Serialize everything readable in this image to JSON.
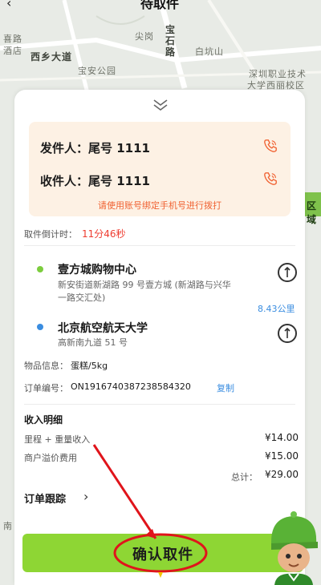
{
  "header": {
    "title": "待取件",
    "back_icon": "chevron-left-icon"
  },
  "map": {
    "labels": [
      "喜路",
      "酒店",
      "西乡大道",
      "尖岗",
      "宝石路",
      "白坑山",
      "宝安公园",
      "深圳职业技术",
      "大学西丽校区",
      "区域",
      "南"
    ]
  },
  "contact": {
    "sender_label": "发件人：尾号 1111",
    "receiver_label": "收件人：尾号 1111",
    "note": "请使用账号绑定手机号进行拨打",
    "accent": "#f06232"
  },
  "countdown": {
    "label": "取件倒计时：",
    "value": "11分46秒"
  },
  "pickup": {
    "name": "壹方城购物中心",
    "address_line1": "新安街道新湖路 99 号壹方城 (新湖路与兴华",
    "address_line2": "一路交汇处)",
    "dot_color": "#7ccd3e"
  },
  "distance": "8.43公里",
  "dropoff": {
    "name": "北京航空航天大学",
    "address": "高新南九道 51 号",
    "dot_color": "#3a8de0"
  },
  "item": {
    "label": "物品信息：",
    "value": "蛋糕/5kg"
  },
  "order": {
    "label": "订单编号：",
    "number": "ON1916740387238584320",
    "copy": "复制"
  },
  "income": {
    "title": "收入明细",
    "rows": [
      {
        "label": "里程 + 重量收入",
        "amount": "¥14.00"
      },
      {
        "label": "商户溢价费用",
        "amount": "¥15.00"
      }
    ],
    "total_label": "总计：",
    "total_amount": "¥29.00"
  },
  "tracking": {
    "label": "订单跟踪"
  },
  "confirm": {
    "label": "确认取件",
    "color": "#8ed634"
  },
  "annotation_color": "#e0141b"
}
